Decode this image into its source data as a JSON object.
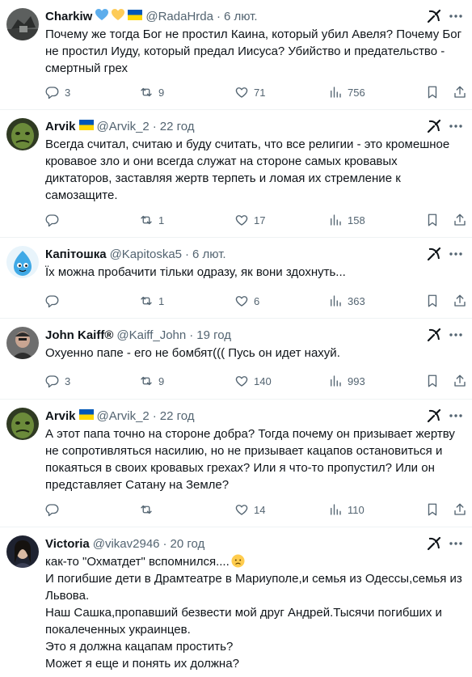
{
  "tweets": [
    {
      "name": "Charkiw",
      "emojis": [
        "blue-heart",
        "yellow-heart",
        "ukraine-flag"
      ],
      "handle": "@RadaHrda",
      "dot": "·",
      "time": "6 лют.",
      "text": "Почему же тогда Бог не простил Каина, который убил Авеля? Почему Бог\nне простил Иуду, который предал Иисуса? Убийство и предательство -\nсмертный грех",
      "replies": "3",
      "reposts": "9",
      "likes": "71",
      "views": "756"
    },
    {
      "name": "Arvik",
      "emojis": [
        "ukraine-flag"
      ],
      "handle": "@Arvik_2",
      "dot": "·",
      "time": "22 год",
      "text": "Всегда считал, считаю и буду считать, что все религии - это кромешное\nкровавое зло и они всегда служат на стороне самых кровавых\nдиктаторов, заставляя жертв терпеть и ломая их стремление к\nсамозащите.",
      "replies": "",
      "reposts": "1",
      "likes": "17",
      "views": "158"
    },
    {
      "name": "Капітошка",
      "emojis": [],
      "handle": "@Kapitoska5",
      "dot": "·",
      "time": "6 лют.",
      "text": "Їх можна пробачити тільки одразу, як вони здохнуть...",
      "replies": "",
      "reposts": "1",
      "likes": "6",
      "views": "363"
    },
    {
      "name": "John Kaiff®",
      "emojis": [],
      "handle": "@Kaiff_John",
      "dot": "·",
      "time": "19 год",
      "text": "Охуенно папе - его не бомбят((( Пусь он идет нахуй.",
      "replies": "3",
      "reposts": "9",
      "likes": "140",
      "views": "993"
    },
    {
      "name": "Arvik",
      "emojis": [
        "ukraine-flag"
      ],
      "handle": "@Arvik_2",
      "dot": "·",
      "time": "22 год",
      "text": "А этот папа точно на стороне добра? Тогда почему он призывает жертву\nне сопротивляться насилию, но не призывает кацапов остановиться и\nпокаяться в своих кровавых грехах? Или я что-то пропустил? Или он\nпредставляет Сатану на Земле?",
      "replies": "",
      "reposts": "",
      "likes": "14",
      "views": "110"
    },
    {
      "name": "Victoria",
      "emojis": [],
      "handle": "@vikav2946",
      "dot": "·",
      "time": "20 год",
      "text": "как-то \"Охматдет\" вспомнился....",
      "text_emoji": "disappointed-face",
      "text_rest": "И погибшие дети в Драмтеатре в Мариуполе,и семья из Одессы,семья из\nЛьвова.\nНаш Сашка,пропавший безвести мой друг Андрей.Тысячи погибших и\nпокалеченных украинцев.\nЭто я должна кацапам простить?\nМожет я еще и понять их должна?"
    }
  ],
  "colors": {
    "text": "#0f1419",
    "secondary": "#536471",
    "divider": "#eff3f4",
    "flag_blue": "#0057b7",
    "flag_yellow": "#ffd700",
    "heart_blue": "#5dadec",
    "heart_yellow": "#fdcb58"
  }
}
